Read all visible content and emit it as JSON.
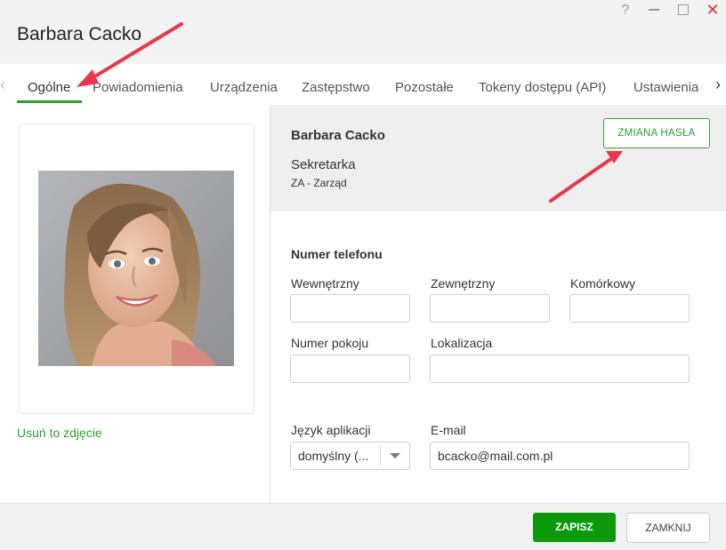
{
  "window": {
    "title": "Barbara Cacko",
    "controls": {
      "help": "?",
      "close": "✕"
    }
  },
  "tabs": [
    {
      "label": "Ogólne",
      "active": true
    },
    {
      "label": "Powiadomienia"
    },
    {
      "label": "Urządzenia"
    },
    {
      "label": "Zastępstwo"
    },
    {
      "label": "Pozostałe"
    },
    {
      "label": "Tokeny dostępu (API)"
    },
    {
      "label": "Ustawienia"
    }
  ],
  "tab_arrows": {
    "left": "‹",
    "right": "›"
  },
  "profile": {
    "remove_photo_label": "Usuń to zdjęcie",
    "name": "Barbara Cacko",
    "role": "Sekretarka",
    "department": "ZA - Zarząd",
    "change_password_label": "ZMIANA HASŁA"
  },
  "phone": {
    "section_title": "Numer telefonu",
    "internal_label": "Wewnętrzny",
    "internal_value": "",
    "external_label": "Zewnętrzny",
    "external_value": "",
    "mobile_label": "Komórkowy",
    "mobile_value": ""
  },
  "room": {
    "label": "Numer pokoju",
    "value": ""
  },
  "location": {
    "label": "Lokalizacja",
    "value": ""
  },
  "language": {
    "label": "Język aplikacji",
    "selected": "domyślny (..."
  },
  "email": {
    "label": "E-mail",
    "value": "bcacko@mail.com.pl"
  },
  "footer": {
    "save_label": "ZAPISZ",
    "close_label": "ZAMKNIJ"
  },
  "colors": {
    "accent_green": "#2e9e2e",
    "primary_button": "#0c9a0c",
    "annotation_arrow": "#e8374f",
    "close_icon": "#d9342b"
  }
}
